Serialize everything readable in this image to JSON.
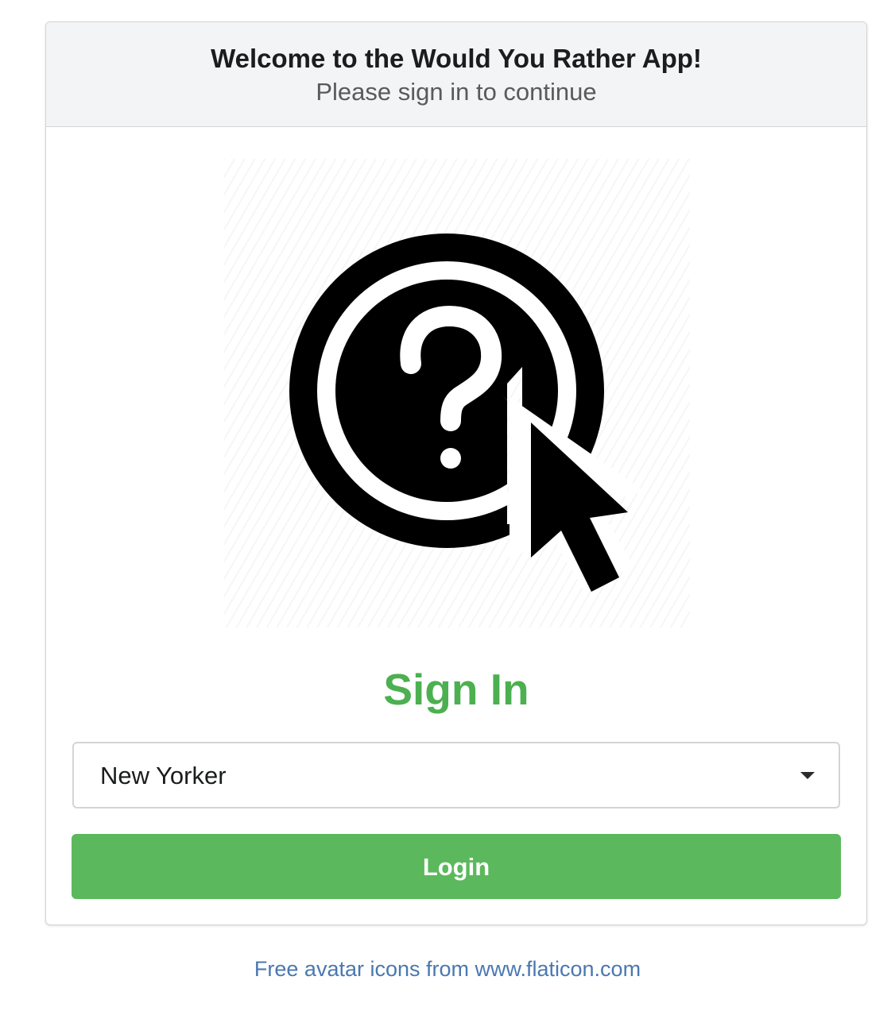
{
  "header": {
    "title": "Welcome to the Would You Rather App!",
    "subtitle": "Please sign in to continue"
  },
  "logo": {
    "icon": "question-cursor-icon"
  },
  "signin": {
    "title": "Sign In",
    "title_color": "#4cb050"
  },
  "user_select": {
    "selected": "New Yorker"
  },
  "login_button": {
    "label": "Login",
    "color": "#5cb85c"
  },
  "footer": {
    "link_text": "Free avatar icons from www.flaticon.com",
    "link_color": "#4a78b0"
  }
}
